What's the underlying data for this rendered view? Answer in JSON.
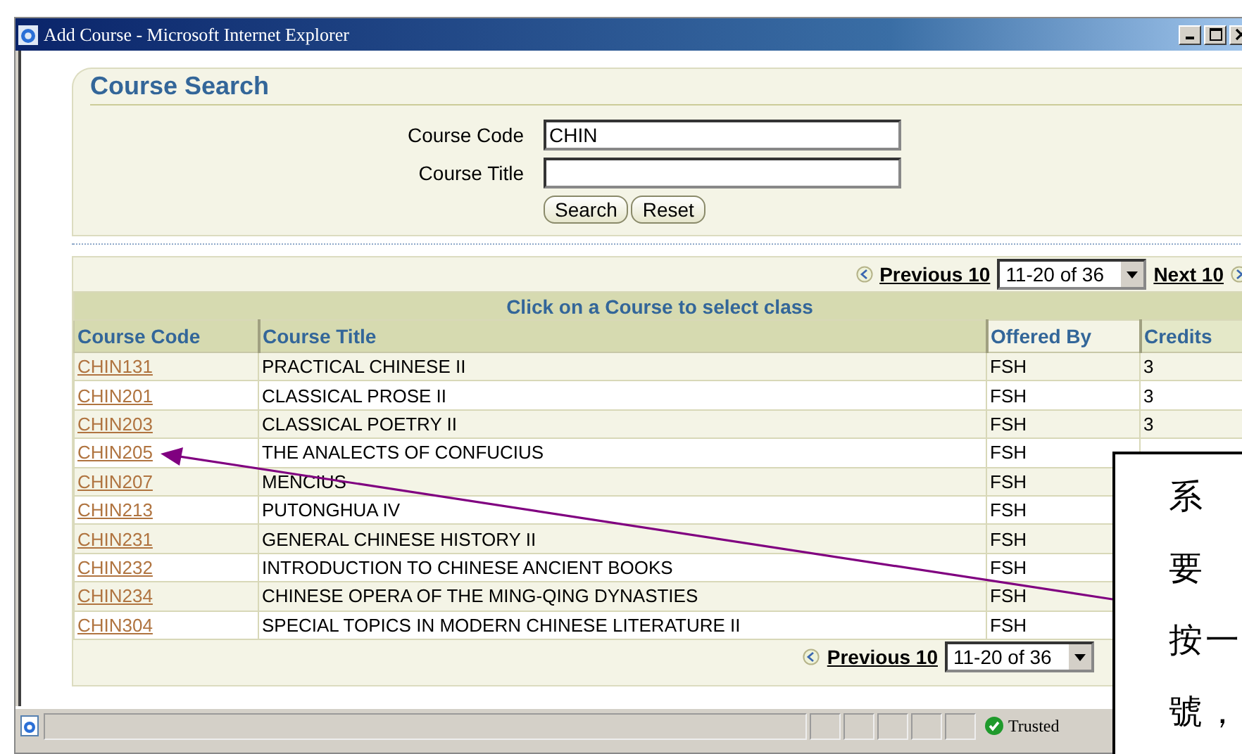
{
  "window": {
    "title": "Add Course - Microsoft Internet Explorer"
  },
  "search": {
    "title": "Course Search",
    "fields": [
      {
        "label": "Course Code",
        "value": "CHIN"
      },
      {
        "label": "Course Title"
      }
    ],
    "buttons": [
      "Search",
      "Reset"
    ]
  },
  "pagination": {
    "previous": "Previous 10",
    "range": "11-20 of 36",
    "next": "Next 10"
  },
  "table": {
    "caption": "Click on a Course to select class",
    "columns": [
      "Course Code",
      "Course Title",
      "Offered By",
      "Credits"
    ],
    "rows": [
      {
        "code": "CHIN131",
        "title": "PRACTICAL CHINESE II",
        "offered_by": "FSH",
        "credits": "3"
      },
      {
        "code": "CHIN201",
        "title": "CLASSICAL PROSE II",
        "offered_by": "FSH",
        "credits": "3"
      },
      {
        "code": "CHIN203",
        "title": "CLASSICAL POETRY II",
        "offered_by": "FSH",
        "credits": "3"
      },
      {
        "code": "CHIN205",
        "title": "THE ANALECTS OF CONFUCIUS",
        "offered_by": "FSH"
      },
      {
        "code": "CHIN207",
        "title": "MENCIUS",
        "offered_by": "FSH"
      },
      {
        "code": "CHIN213",
        "title": "PUTONGHUA IV",
        "offered_by": "FSH"
      },
      {
        "code": "CHIN231",
        "title": "GENERAL CHINESE HISTORY II",
        "offered_by": "FSH"
      },
      {
        "code": "CHIN232",
        "title": "INTRODUCTION TO CHINESE ANCIENT BOOKS",
        "offered_by": "FSH"
      },
      {
        "code": "CHIN234",
        "title": "CHINESE OPERA OF THE MING-QING DYNASTIES",
        "offered_by": "FSH"
      },
      {
        "code": "CHIN304",
        "title": "SPECIAL TOPICS IN MODERN CHINESE LITERATURE II",
        "offered_by": "FSH"
      }
    ]
  },
  "bottom_pagination": {
    "previous": "Previous 10",
    "range": "11-20 of 36"
  },
  "status_bar": {
    "zone": "Trusted"
  },
  "callout": {
    "lines": [
      "系",
      "要",
      "按一",
      "號，"
    ]
  }
}
